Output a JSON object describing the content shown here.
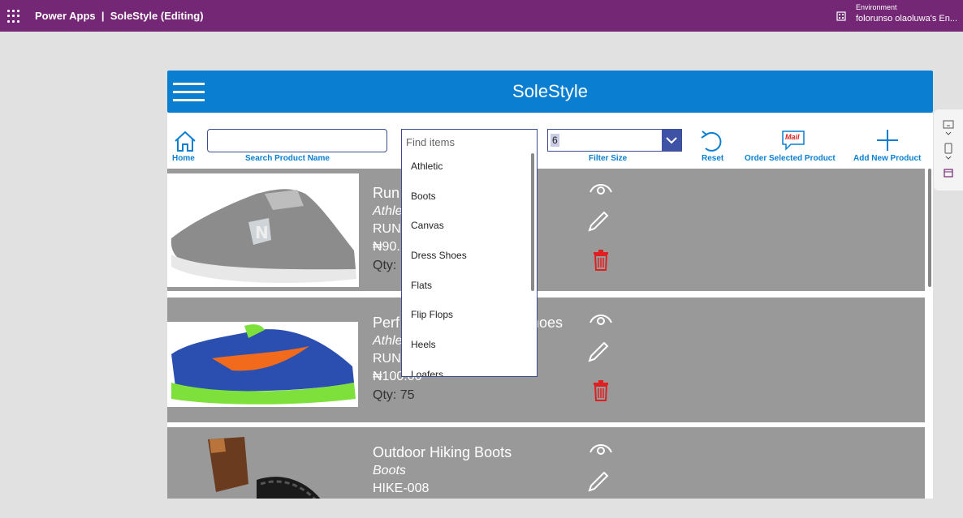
{
  "topbar": {
    "app_title": "Power Apps  |  SoleStyle (Editing)",
    "env_label": "Environment",
    "env_name": "folorunso olaoluwa's En..."
  },
  "app": {
    "name": "SoleStyle",
    "toolbar": {
      "home_label": "Home",
      "search_label": "Search Product Name",
      "search_value": "",
      "find_placeholder": "Find items",
      "filter_size_label": "Filter Size",
      "filter_size_value": "6",
      "reset_label": "Reset",
      "order_label": "Order Selected Product",
      "mail_badge": "Mail",
      "add_label": "Add New Product"
    },
    "dropdown_items": [
      "Athletic",
      "Boots",
      "Canvas",
      "Dress Shoes",
      "Flats",
      "Flip Flops",
      "Heels",
      "Loafers"
    ],
    "products": [
      {
        "name": "Run",
        "category": "Athle",
        "sku": "RUN",
        "price": "₦90.",
        "qty": "Qty:"
      },
      {
        "name_left": "Perf",
        "name_right": "hoes",
        "category": "Athle",
        "sku": "RUN",
        "price": "₦100.00",
        "qty": "Qty: 75"
      },
      {
        "name": "Outdoor Hiking Boots",
        "category": "Boots",
        "sku": "HIKE-008"
      }
    ]
  },
  "colors": {
    "topbar": "#742774",
    "header": "#0a7fd1",
    "row_bg": "#999999",
    "delete": "#e02020"
  }
}
